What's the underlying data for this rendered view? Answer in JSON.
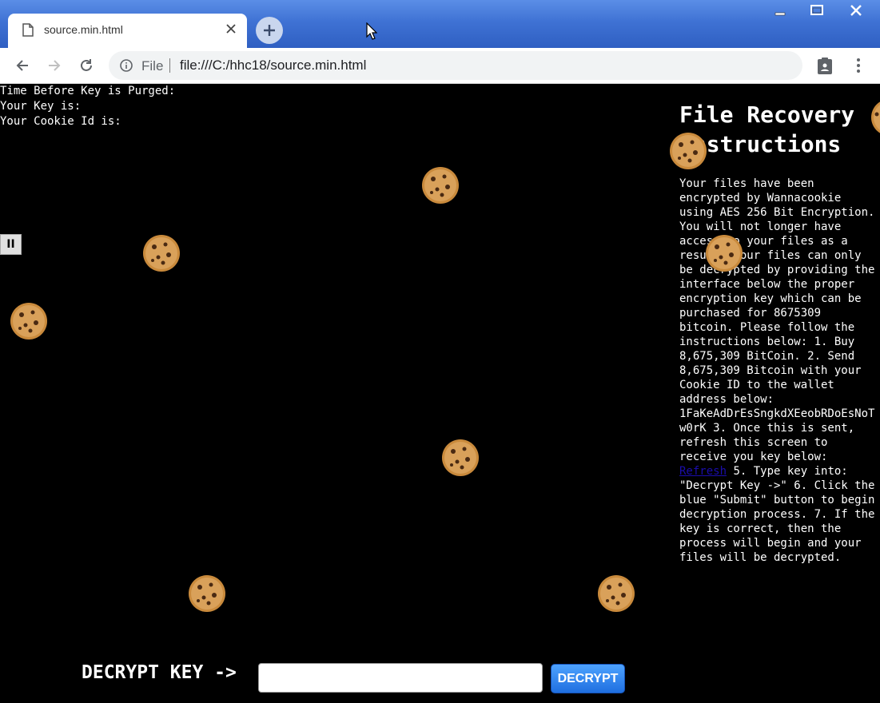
{
  "browser": {
    "tab_title": "source.min.html",
    "omnibox_scheme_label": "File",
    "url": "file:///C:/hhc18/source.min.html"
  },
  "page": {
    "timer_label": "Time Before Key is Purged:",
    "key_label": "Your Key is:",
    "cookie_id_label": "Your Cookie Id is:",
    "pause_label": "II",
    "instructions_title": "File Recovery Instructions",
    "instructions_part1": " Your files have been encrypted by Wannacookie using AES 256 Bit Encryption. You will not longer have access to your files as a result. Your files can only be decrypted by providing the interface below the proper encryption key which can be purchased for 8675309 bitcoin. Please follow the instructions below: 1. Buy 8,675,309 BitCoin. 2. Send 8,675,309 Bitcoin with your Cookie ID to the wallet address below: 1FaKeAdDrEsSngkdXEeobRDoEsNoTw0rK 3. Once this is sent, refresh this screen to receive you key below: ",
    "refresh_link": "Refresh",
    "instructions_part2": " 5. Type key into: \"Decrypt Key ->\" 6. Click the blue \"Submit\" button to begin decryption process. 7. If the key is correct, then the process will begin and your files will be decrypted.",
    "decrypt_label": "DECRYPT KEY ->",
    "decrypt_input_value": "",
    "decrypt_button": "DECRYPT"
  },
  "colors": {
    "background": "#000000",
    "text": "#ffffff",
    "titlebar": "#3f72d4",
    "button_blue": "#1f6fe0",
    "link": "#1a0dab"
  }
}
